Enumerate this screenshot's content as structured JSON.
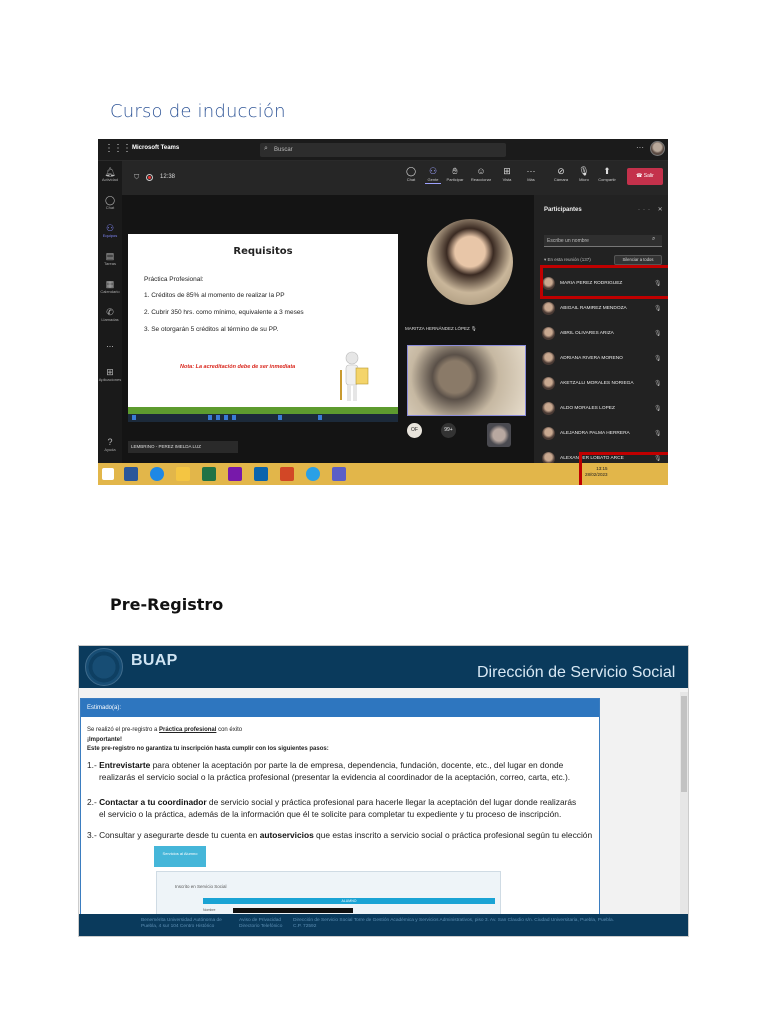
{
  "doc": {
    "section1": "Curso de inducción",
    "section2": "Pre-Registro"
  },
  "teams": {
    "app_name": "Microsoft Teams",
    "search_placeholder": "Buscar",
    "rail": [
      "Actividad",
      "Chat",
      "Equipos",
      "Tareas",
      "Calendario",
      "Llamadas",
      "...",
      "Aplicaciones",
      "Ayuda"
    ],
    "timer": "12:38",
    "toolbar": [
      "Chat",
      "Gente",
      "Participar",
      "Reaccionar",
      "Vista",
      "Más",
      "Cámara",
      "Micro",
      "Compartir"
    ],
    "leave": "Salir",
    "slide": {
      "title": "Requisitos",
      "subtitle": "Práctica Profesional:",
      "items": [
        "1. Créditos de 85% al momento de realizar la PP",
        "2. Cubrir 350 hrs. como mínimo, equivalente a 3 meses",
        "3. Se otorgarán 5 créditos al término de su PP."
      ],
      "note": "Nota: La acreditación debe de ser inmediata"
    },
    "presenter": "LEMBRINO - PEREZ IMELDA LUZ",
    "camera_name": "MARITZA HERNÁNDEZ LÓPEZ",
    "chip_initials": "OF",
    "chip_count": "99+",
    "panel": {
      "title": "Participantes",
      "search_placeholder": "Escribe un nombre",
      "in_meeting": "En esta reunión (137)",
      "mute_all": "Silenciar a todos",
      "participants": [
        "MARIA PEREZ RODRIGUEZ",
        "ABIGAIL RAMIREZ MENDOZA",
        "ABRIL OLIVARES ARIZA",
        "ADRIANA RIVERA MORENO",
        "AKETZALLI MORALES NORIEGA",
        "ALDO MORALES LOPEZ",
        "ALEJANDRA PALMA HERRERA",
        "ALEXANDER LOBATO ARCE"
      ]
    },
    "tray_time": "13:15",
    "tray_date": "28/02/2023"
  },
  "buap": {
    "logo": "BUAP",
    "department": "Dirección de Servicio Social",
    "card_title": "Estimado(a):",
    "line1_pre": "Se realizó el pre-registro a ",
    "line1_link": "Práctica profesional",
    "line1_post": " con éxito",
    "important": "¡Importante!",
    "warning": "Este pre-registro no garantiza tu inscripción hasta cumplir con los siguientes pasos:",
    "step1_num": "1.- ",
    "step1_bold": "Entrevistarte",
    "step1_a": " para obtener la aceptación por parte la de empresa, dependencia, fundación, docente, etc., del lugar en donde",
    "step1_b": "realizarás el servicio social o la práctica profesional (presentar la evidencia al coordinador de la aceptación, correo, carta, etc.).",
    "step2_num": "2.- ",
    "step2_bold": "Contactar a tu coordinador",
    "step2_a": " de servicio social y práctica profesional para hacerle llegar la aceptación del lugar donde realizarás",
    "step2_b": "el servicio o la práctica, además de la información que él te solicite para completar tu expediente y tu proceso de inscripción.",
    "step3_pre": "3.- Consultar y asegurarte desde tu cuenta en ",
    "step3_bold": "autoservicios",
    "step3_post": " que estas inscrito a servicio social o práctica profesional según tu elección",
    "button": "Servicios al Alumno",
    "inner_title": "Inscrito en Servicio Social",
    "inner_bar": "ALUMNO",
    "inner_label": "Nombre",
    "footer1": "Benemérita Universidad Autónoma de Puebla, 4 sur 104 Centro Histórico",
    "footer2": "Aviso de Privacidad   Directorio Telefónico",
    "footer3": "Dirección de Servicio Social   Torre de Gestión Académica y Servicios Administrativos, piso 3. Av. San Claudio s/n. Ciudad Universitaria, Puebla, Puebla. C.P. 72592"
  },
  "colors": {
    "heading_blue": "#2F5597",
    "teams_leave": "#c4314b",
    "highlight_red": "#c00000",
    "buap_navy": "#0a3a5c",
    "buap_card_blue": "#2e76bf"
  }
}
